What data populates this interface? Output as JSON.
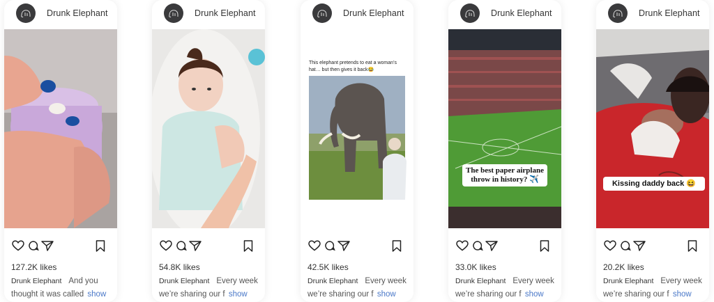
{
  "brand_name": "Drunk Elephant",
  "icons": {
    "avatar": "elephant-logo-icon",
    "like": "heart-icon",
    "comment": "comment-bubble-icon",
    "share": "paper-plane-icon",
    "save": "bookmark-icon"
  },
  "colors": {
    "show_link": "#4a78c8",
    "avatar_bg": "#3a3a3c"
  },
  "posts": [
    {
      "likes": "127.2K likes",
      "username": "Drunk Elephant",
      "caption": "And you thought it was called",
      "more": "show",
      "overlay": ""
    },
    {
      "likes": "54.8K likes",
      "username": "Drunk Elephant",
      "caption": "Every week we’re sharing our f",
      "more": "show",
      "overlay": ""
    },
    {
      "likes": "42.5K likes",
      "username": "Drunk Elephant",
      "caption": "Every week we’re sharing our f",
      "more": "show",
      "overlay": "This elephant pretends to eat a woman’s hat… but then gives it back😂"
    },
    {
      "likes": "33.0K likes",
      "username": "Drunk Elephant",
      "caption": "Every week we’re sharing our f",
      "more": "show",
      "overlay": "The best paper airplane throw in history? ✈️"
    },
    {
      "likes": "20.2K likes",
      "username": "Drunk Elephant",
      "caption": "Every week we’re sharing our f",
      "more": "show",
      "overlay": "Kissing daddy back 😆"
    }
  ]
}
